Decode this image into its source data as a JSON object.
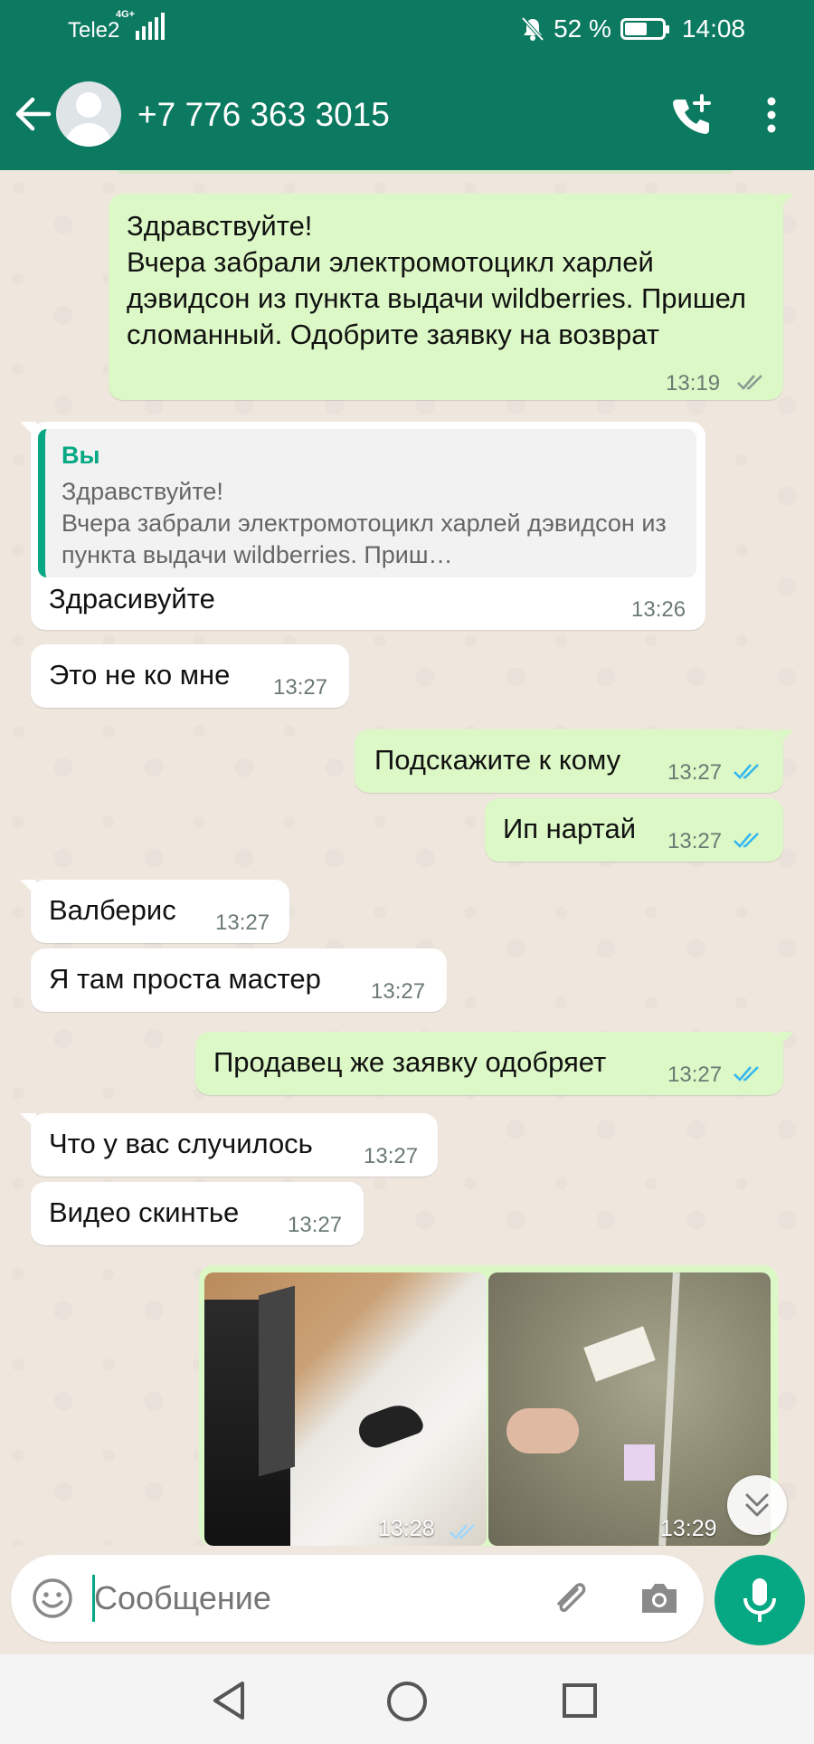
{
  "status_bar": {
    "carrier": "Tele2",
    "network": "4G+",
    "battery": "52 %",
    "time": "14:08"
  },
  "header": {
    "contact": "+7 776 363 3015"
  },
  "messages": [
    {
      "dir": "out",
      "text": "Здравствуйте!\nВчера забрали электромотоцикл харлей дэвидсон из пункта выдачи wildberries. Пришел сломанный. Одобрите заявку на возврат",
      "time": "13:19",
      "status": "delivered"
    },
    {
      "dir": "in",
      "quote_author": "Вы",
      "quote_text": "Здравствуйте!\nВчера забрали электромотоцикл харлей дэвидсон из пункта выдачи wildberries. Приш…",
      "text": "Здрасивуйте",
      "time": "13:26"
    },
    {
      "dir": "in",
      "text": "Это не ко мне",
      "time": "13:27"
    },
    {
      "dir": "out",
      "text": "Подскажите к кому",
      "time": "13:27",
      "status": "read"
    },
    {
      "dir": "out",
      "text": "Ип нартай",
      "time": "13:27",
      "status": "read"
    },
    {
      "dir": "in",
      "text": "Валберис",
      "time": "13:27"
    },
    {
      "dir": "in",
      "text": "Я там проста мастер",
      "time": "13:27"
    },
    {
      "dir": "out",
      "text": "Продавец же заявку одобряет",
      "time": "13:27",
      "status": "read"
    },
    {
      "dir": "in",
      "text": "Что у вас случилось",
      "time": "13:27"
    },
    {
      "dir": "in",
      "text": "Видео скинтье",
      "time": "13:27"
    },
    {
      "dir": "out",
      "media": true,
      "items": [
        {
          "time": "13:28",
          "status": "read"
        },
        {
          "time": "13:29",
          "status": "read"
        }
      ]
    }
  ],
  "input": {
    "placeholder": "Сообщение"
  },
  "colors": {
    "header": "#0c7a61",
    "outgoing": "#dcf8c6",
    "incoming": "#ffffff",
    "accent": "#06a884",
    "read_ticks": "#34b7f1",
    "delivered_ticks": "#8a9a93"
  }
}
